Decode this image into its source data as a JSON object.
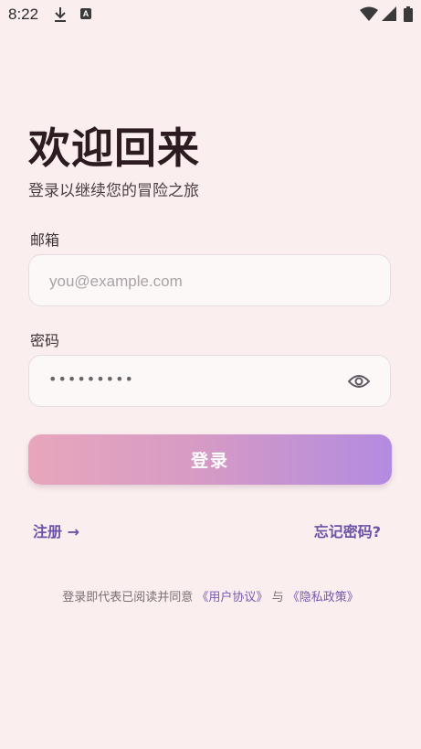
{
  "status_bar": {
    "time": "8:22",
    "a_badge": "A"
  },
  "header": {
    "title": "欢迎回来",
    "subtitle": "登录以继续您的冒险之旅"
  },
  "form": {
    "email_label": "邮箱",
    "email_placeholder": "you@example.com",
    "email_value": "",
    "password_label": "密码",
    "password_masked": "•••••••••",
    "login_label": "登录"
  },
  "links": {
    "register": "注册 →",
    "forgot": "忘记密码?"
  },
  "footer": {
    "prefix": "登录即代表已阅读并同意",
    "user_agreement": "《用户协议》",
    "and": "与",
    "privacy_policy": "《隐私政策》"
  },
  "icons": [
    "download-icon",
    "a-badge-icon",
    "wifi-icon",
    "signal-icon",
    "battery-icon",
    "eye-icon"
  ],
  "colors": {
    "background": "#faeeee",
    "accent": "#6c52a8",
    "button_start": "#e8a6bc",
    "button_end": "#b38be0"
  }
}
